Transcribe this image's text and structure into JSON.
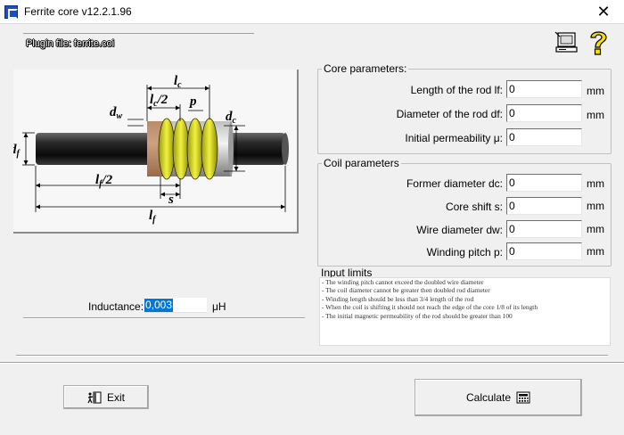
{
  "window": {
    "title": "Ferrite core v12.2.1.96",
    "close_glyph": "✕"
  },
  "plugin": {
    "label": "Plugin file: ferrite.coi"
  },
  "toolbar": {
    "computer_icon": "computer-help-icon",
    "help_icon": "question-help-icon"
  },
  "diagram": {
    "labels": {
      "lc": "l",
      "lc_sub": "c",
      "lc2": "l",
      "lc2_sub": "c",
      "lc2_div": "/2",
      "p": "p",
      "dw": "d",
      "dw_sub": "w",
      "dc": "d",
      "dc_sub": "c",
      "df": "d",
      "df_sub": "f",
      "lf2": "l",
      "lf2_sub": "f",
      "lf2_div": "/2",
      "s": "s",
      "lf": "l",
      "lf_sub": "f"
    }
  },
  "core": {
    "title": "Core parameters:",
    "rows": [
      {
        "label": "Length of the rod lf:",
        "value": "0",
        "unit": "mm"
      },
      {
        "label": "Diameter of the rod df:",
        "value": "0",
        "unit": "mm"
      },
      {
        "label": "Initial permeability μ:",
        "value": "0",
        "unit": ""
      }
    ]
  },
  "coil": {
    "title": "Coil parameters",
    "rows": [
      {
        "label": "Former diameter dc:",
        "value": "0",
        "unit": "mm"
      },
      {
        "label": "Core shift s:",
        "value": "0",
        "unit": "mm"
      },
      {
        "label": "Wire diameter dw:",
        "value": "0",
        "unit": "mm"
      },
      {
        "label": "Winding pitch p:",
        "value": "0",
        "unit": "mm"
      }
    ]
  },
  "limits": {
    "title": "Input limits",
    "lines": [
      "- The winding pitch cannot exceed the doubled wire diameter",
      "- The coil diameter cannot be greater then doubled rod diameter",
      "- Winding length should be less than 3/4 length of the rod",
      "- When the coil is shifting it should not reach the edge of the core 1/8 of its length",
      "- The initial magnetic permeability of the rod should be greater than 100"
    ]
  },
  "inductance": {
    "label": "Inductance:",
    "value": "0,003",
    "unit": "μH"
  },
  "buttons": {
    "exit": "Exit",
    "calculate": "Calculate"
  }
}
